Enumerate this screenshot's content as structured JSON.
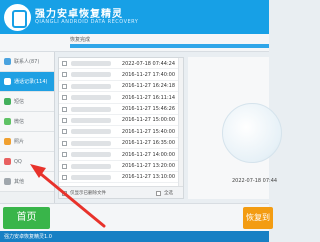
{
  "app": {
    "title": "强力安卓恢复精灵",
    "subtitle": "QIANGLI ANDROID DATA RECOVERY",
    "brand_color": "#17a0e6"
  },
  "toolbar": {
    "progress_label": "恢复完成",
    "progress": 1.0
  },
  "sidebar": {
    "items": [
      {
        "label": "联系人(87)",
        "icon": "contacts-icon",
        "color": "#4aa3df",
        "active": false
      },
      {
        "label": "通话记录(114)",
        "icon": "call-log-icon",
        "color": "#ffffff",
        "active": true
      },
      {
        "label": "短信",
        "icon": "sms-icon",
        "color": "#43b05c",
        "active": false
      },
      {
        "label": "微信",
        "icon": "wechat-icon",
        "color": "#5ec265",
        "active": false
      },
      {
        "label": "照片",
        "icon": "photo-icon",
        "color": "#f0a030",
        "active": false
      },
      {
        "label": "QQ",
        "icon": "qq-icon",
        "color": "#e86060",
        "active": false
      },
      {
        "label": "其他",
        "icon": "other-icon",
        "color": "#a0a7ad",
        "active": false
      }
    ]
  },
  "list": {
    "rows": [
      {
        "time": "2022-07-18 07:44:24"
      },
      {
        "time": "2016-11-27 17:40:00"
      },
      {
        "time": "2016-11-27 16:24:18"
      },
      {
        "time": "2016-11-27 16:11:14"
      },
      {
        "time": "2016-11-27 15:46:26"
      },
      {
        "time": "2016-11-27 15:00:00"
      },
      {
        "time": "2016-11-27 15:40:00"
      },
      {
        "time": "2016-11-27 16:35:00"
      },
      {
        "time": "2016-11-27 14:00:00"
      },
      {
        "time": "2016-11-27 13:20:00"
      },
      {
        "time": "2016-11-27 13:10:00"
      }
    ],
    "footer": {
      "show_deleted_label": "仅显示已删除文件",
      "select_all_label": "全选"
    }
  },
  "preview": {
    "time": "2022-07-18 07:44"
  },
  "bottombar": {
    "home_label": "首页",
    "recover_label": "恢复到"
  },
  "status": {
    "text": "强力安卓恢复精灵1.0"
  }
}
